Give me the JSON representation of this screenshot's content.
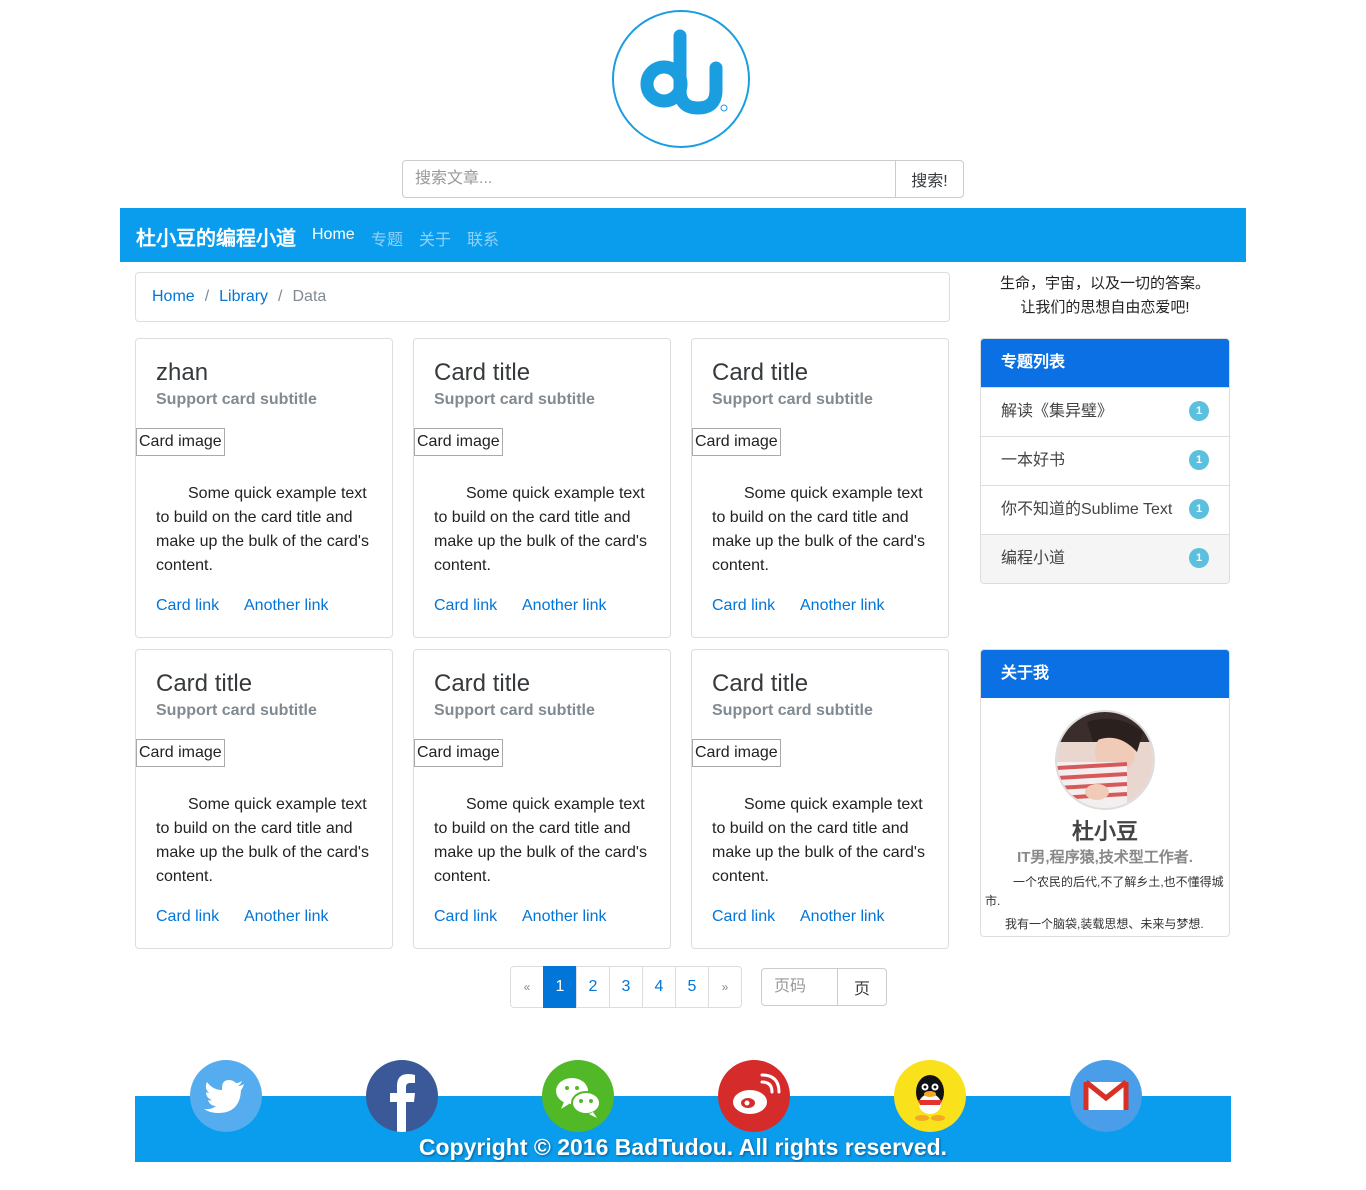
{
  "logo": {
    "alt": "du"
  },
  "search": {
    "placeholder": "搜索文章...",
    "button": "搜索!"
  },
  "navbar": {
    "brand": "杜小豆的编程小道",
    "links": [
      {
        "label": "Home",
        "active": true
      },
      {
        "label": "专题",
        "active": false
      },
      {
        "label": "关于",
        "active": false
      },
      {
        "label": "联系",
        "active": false
      }
    ]
  },
  "breadcrumb": {
    "items": [
      "Home",
      "Library",
      "Data"
    ],
    "separator": "/"
  },
  "cards": [
    {
      "title": "zhan",
      "subtitle": "Support card subtitle",
      "image": "Card image",
      "text": "Some quick example text to build on the card title and make up the bulk of the card's content.",
      "link1": "Card link",
      "link2": "Another link"
    },
    {
      "title": "Card title",
      "subtitle": "Support card subtitle",
      "image": "Card image",
      "text": "Some quick example text to build on the card title and make up the bulk of the card's content.",
      "link1": "Card link",
      "link2": "Another link"
    },
    {
      "title": "Card title",
      "subtitle": "Support card subtitle",
      "image": "Card image",
      "text": "Some quick example text to build on the card title and make up the bulk of the card's content.",
      "link1": "Card link",
      "link2": "Another link"
    },
    {
      "title": "Card title",
      "subtitle": "Support card subtitle",
      "image": "Card image",
      "text": "Some quick example text to build on the card title and make up the bulk of the card's content.",
      "link1": "Card link",
      "link2": "Another link"
    },
    {
      "title": "Card title",
      "subtitle": "Support card subtitle",
      "image": "Card image",
      "text": "Some quick example text to build on the card title and make up the bulk of the card's content.",
      "link1": "Card link",
      "link2": "Another link"
    },
    {
      "title": "Card title",
      "subtitle": "Support card subtitle",
      "image": "Card image",
      "text": "Some quick example text to build on the card title and make up the bulk of the card's content.",
      "link1": "Card link",
      "link2": "Another link"
    }
  ],
  "pagination": {
    "prev": "«",
    "pages": [
      "1",
      "2",
      "3",
      "4",
      "5"
    ],
    "current": "1",
    "next": "»",
    "jump_placeholder": "页码",
    "jump_button": "页"
  },
  "sidebar": {
    "motto": [
      "生命，宇宙，以及一切的答案。",
      "让我们的思想自由恋爱吧!"
    ],
    "topics": {
      "heading": "专题列表",
      "items": [
        {
          "label": "解读《集异璧》",
          "count": "1"
        },
        {
          "label": "一本好书",
          "count": "1"
        },
        {
          "label": "你不知道的Sublime Text",
          "count": "1"
        },
        {
          "label": "编程小道",
          "count": "1"
        }
      ]
    },
    "about": {
      "heading": "关于我",
      "name": "杜小豆",
      "title": "IT男,程序猿,技术型工作者.",
      "bio": [
        "一个农民的后代,不了解乡土,也不懂得城市.",
        "我有一个脑袋,装载思想、未来与梦想."
      ]
    }
  },
  "footer": {
    "copyright": "Copyright © 2016 BadTudou. All rights reserved.",
    "social": [
      "twitter-icon",
      "facebook-icon",
      "wechat-icon",
      "weibo-icon",
      "qq-icon",
      "gmail-icon"
    ]
  },
  "colors": {
    "primary": "#0a9ced",
    "panel": "#0a70e3",
    "link": "#0275d8",
    "badge": "#5bc0de"
  }
}
